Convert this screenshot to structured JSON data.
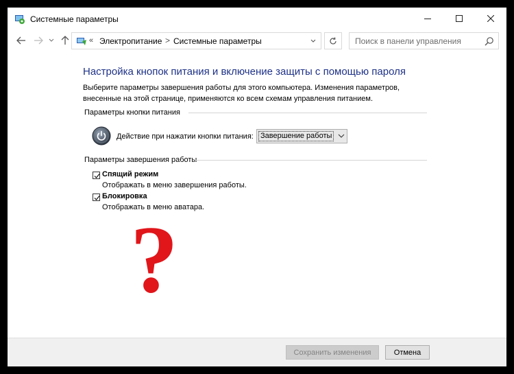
{
  "window": {
    "title": "Системные параметры",
    "minimize_icon": "minimize-icon",
    "maximize_icon": "maximize-icon",
    "close_icon": "close-icon"
  },
  "nav": {
    "breadcrumb_overflow": "«",
    "breadcrumbs": [
      "Электропитание",
      "Системные параметры"
    ],
    "separator": ">",
    "search_placeholder": "Поиск в панели управления"
  },
  "main": {
    "heading": "Настройка кнопок питания и включение защиты с помощью пароля",
    "description": "Выберите параметры завершения работы для этого компьютера. Изменения параметров, внесенные на этой странице, применяются ко всем схемам управления питанием.",
    "power_group_label": "Параметры кнопки питания",
    "power_action_label": "Действие при нажатии кнопки питания:",
    "power_action_value": "Завершение работы",
    "shutdown_group_label": "Параметры завершения работы",
    "options": [
      {
        "title": "Спящий режим",
        "subtitle": "Отображать в меню завершения работы.",
        "checked": true
      },
      {
        "title": "Блокировка",
        "subtitle": "Отображать в меню аватара.",
        "checked": true
      }
    ],
    "overlay_glyph": "?"
  },
  "footer": {
    "save_label": "Сохранить изменения",
    "cancel_label": "Отмена"
  },
  "colors": {
    "heading": "#1e3287",
    "overlay": "#e0161b"
  }
}
